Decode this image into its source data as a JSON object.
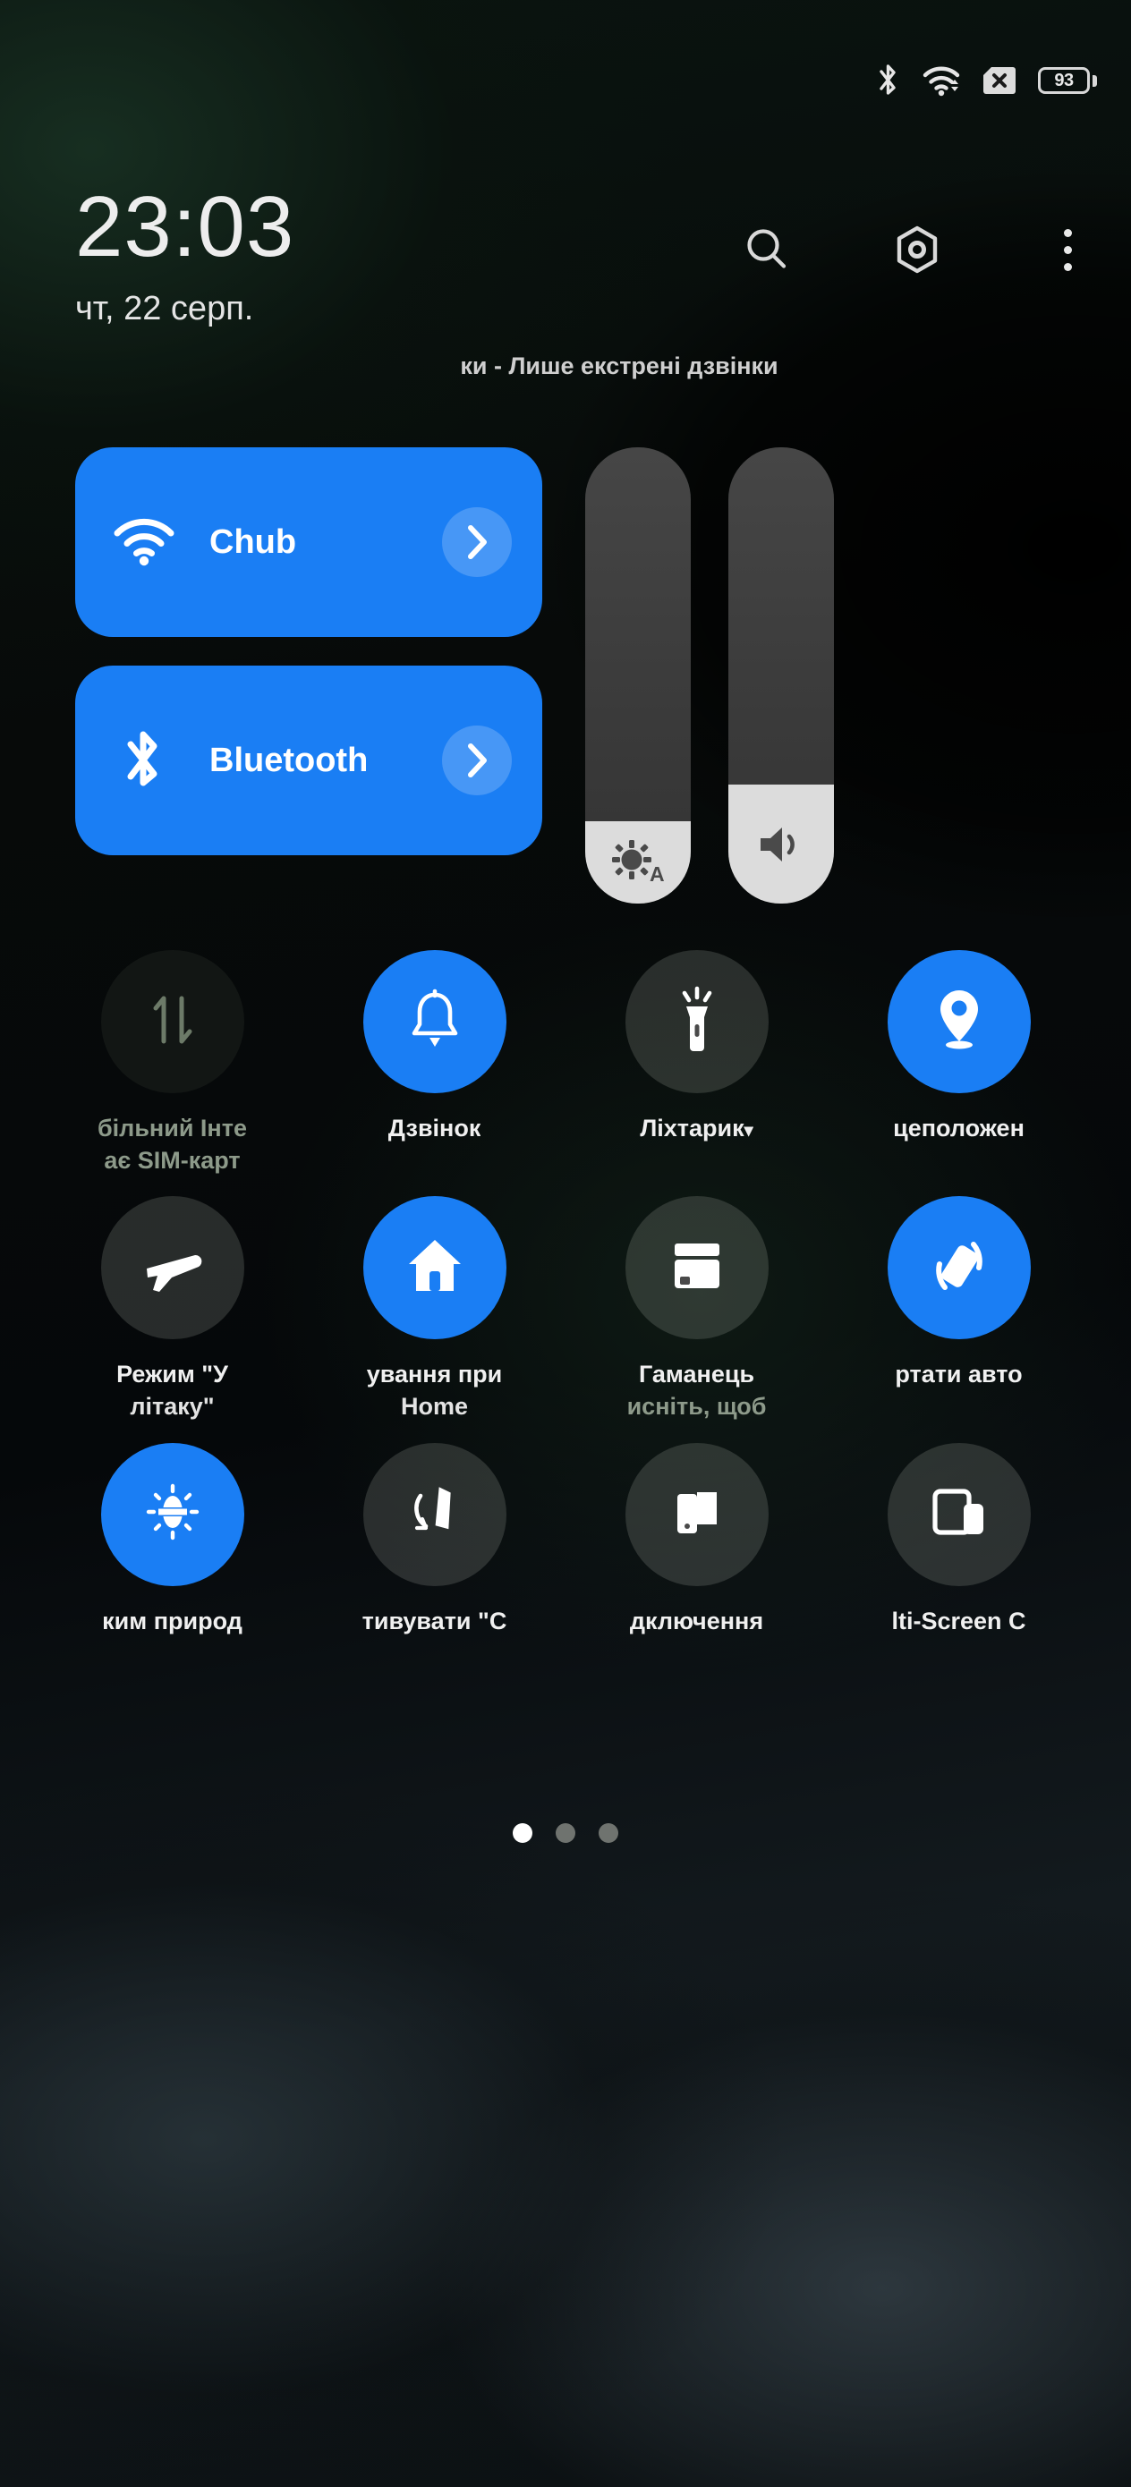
{
  "statusbar": {
    "icons": [
      "bluetooth-icon",
      "wifi-icon",
      "sim-error-icon"
    ],
    "battery_percent": "93"
  },
  "header": {
    "clock": "23:03",
    "date": "чт, 22 серп.",
    "carrier_status": "ки - Лише екстрені дзвінки",
    "actions": [
      {
        "name": "search-icon",
        "label": "Пошук"
      },
      {
        "name": "settings-icon",
        "label": "Налаштування"
      },
      {
        "name": "overflow-menu-icon",
        "label": "Ще"
      }
    ]
  },
  "big_tiles": [
    {
      "id": "wifi",
      "icon": "wifi-icon",
      "label": "Chub",
      "state": "on",
      "chevron": "chevron-right-icon"
    },
    {
      "id": "bluetooth",
      "icon": "bluetooth-icon",
      "label": "Bluetooth",
      "state": "on",
      "chevron": "chevron-right-icon"
    }
  ],
  "sliders": [
    {
      "id": "brightness",
      "icon": "brightness-auto-icon",
      "value_percent": 18,
      "auto_label": "A"
    },
    {
      "id": "volume",
      "icon": "volume-icon",
      "value_percent": 26
    }
  ],
  "quick_settings": [
    {
      "id": "mobile-data",
      "icon": "mobile-data-icon",
      "state": "disabled",
      "label": "більний Інте",
      "sub": "ає SIM-карт",
      "caret": ""
    },
    {
      "id": "ringer",
      "icon": "bell-icon",
      "state": "on",
      "label": "Дзвінок",
      "sub": "",
      "caret": ""
    },
    {
      "id": "flashlight",
      "icon": "flashlight-icon",
      "state": "off",
      "label": "Ліхтарик",
      "sub": "",
      "caret": "▾"
    },
    {
      "id": "location",
      "icon": "location-pin-icon",
      "state": "on",
      "label": "цеположен",
      "sub": "",
      "caret": ""
    },
    {
      "id": "airplane-mode",
      "icon": "airplane-icon",
      "state": "off",
      "label": "Режим \"У",
      "sub": "літаку\"",
      "caret": ""
    },
    {
      "id": "smart-home",
      "icon": "home-icon",
      "state": "on",
      "label": "ування при",
      "sub": "Home",
      "caret": ""
    },
    {
      "id": "wallet",
      "icon": "wallet-icon",
      "state": "off",
      "label": "Гаманець",
      "sub": "исніть, щоб",
      "caret": ""
    },
    {
      "id": "auto-rotate",
      "icon": "auto-rotate-icon",
      "state": "on",
      "label": "ртати авто",
      "sub": "",
      "caret": ""
    },
    {
      "id": "eye-comfort",
      "icon": "sun-nature-icon",
      "state": "on",
      "label": "ким природ",
      "sub": "",
      "caret": ""
    },
    {
      "id": "gesture",
      "icon": "gesture-icon",
      "state": "off",
      "label": "тивувати \"С",
      "sub": "",
      "caret": ""
    },
    {
      "id": "cast",
      "icon": "cast-screen-icon",
      "state": "off",
      "label": "дключення",
      "sub": "",
      "caret": ""
    },
    {
      "id": "multi-screen",
      "icon": "multi-screen-icon",
      "state": "off",
      "label": "lti-Screen C",
      "sub": "",
      "caret": ""
    }
  ],
  "page_dots": {
    "count": 3,
    "active_index": 0
  },
  "colors": {
    "accent_blue": "#1a7ef4",
    "tile_off": "rgba(215,222,210,0.17)",
    "slider_track": "#3d3d3d",
    "slider_fill": "#dcdcdc",
    "text_primary": "#f0f0f0"
  }
}
